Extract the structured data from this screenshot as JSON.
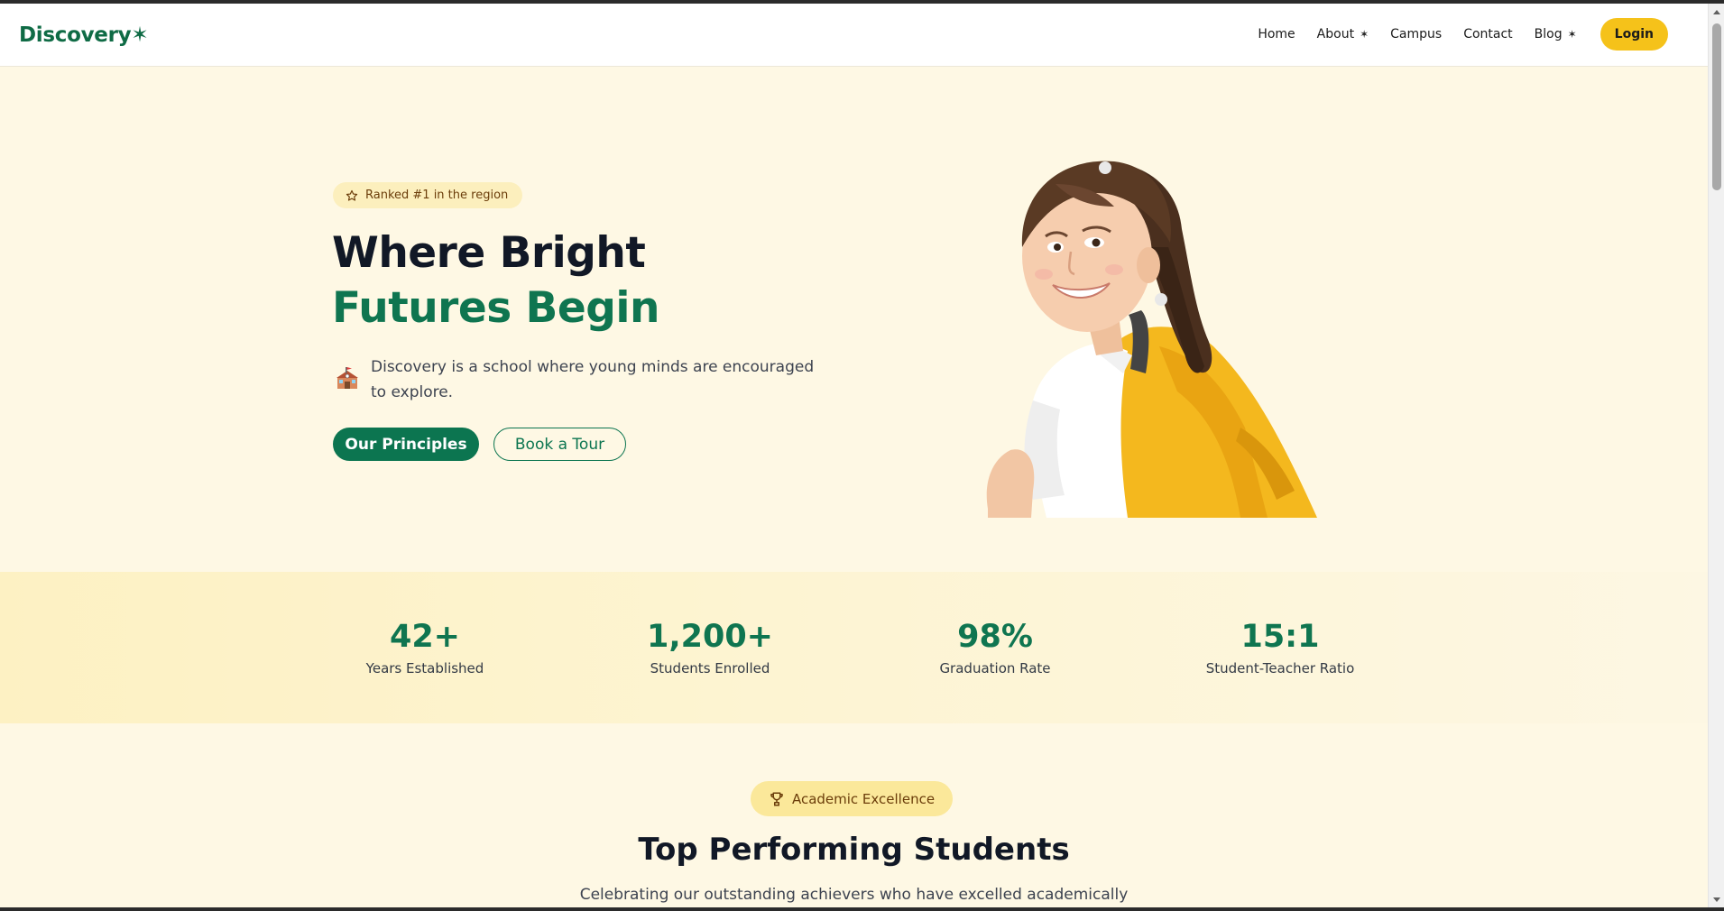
{
  "header": {
    "logo_text": "Discovery",
    "logo_star": "✶",
    "nav": [
      {
        "label": "Home",
        "caret": ""
      },
      {
        "label": "About",
        "caret": "✶"
      },
      {
        "label": "Campus",
        "caret": ""
      },
      {
        "label": "Contact",
        "caret": ""
      },
      {
        "label": "Blog",
        "caret": "✶"
      }
    ],
    "login_label": "Login"
  },
  "hero": {
    "badge": "Ranked #1 in the region",
    "title_line1": "Where Bright",
    "title_line2": "Futures Begin",
    "description": "Discovery is a school where young minds are encouraged to explore.",
    "primary_cta": "Our Principles",
    "secondary_cta": "Book a Tour",
    "icons": {
      "badge": "star-icon",
      "description": "school-icon"
    }
  },
  "stats": [
    {
      "value": "42+",
      "label": "Years Established"
    },
    {
      "value": "1,200+",
      "label": "Students Enrolled"
    },
    {
      "value": "98%",
      "label": "Graduation Rate"
    },
    {
      "value": "15:1",
      "label": "Student-Teacher Ratio"
    }
  ],
  "section": {
    "badge": "Academic Excellence",
    "badge_icon": "trophy-icon",
    "title": "Top Performing Students",
    "subtitle": "Celebrating our outstanding achievers who have excelled academically"
  },
  "colors": {
    "brand_green": "#0f7550",
    "accent_yellow": "#f5c21a",
    "page_bg": "#fef8e4"
  }
}
